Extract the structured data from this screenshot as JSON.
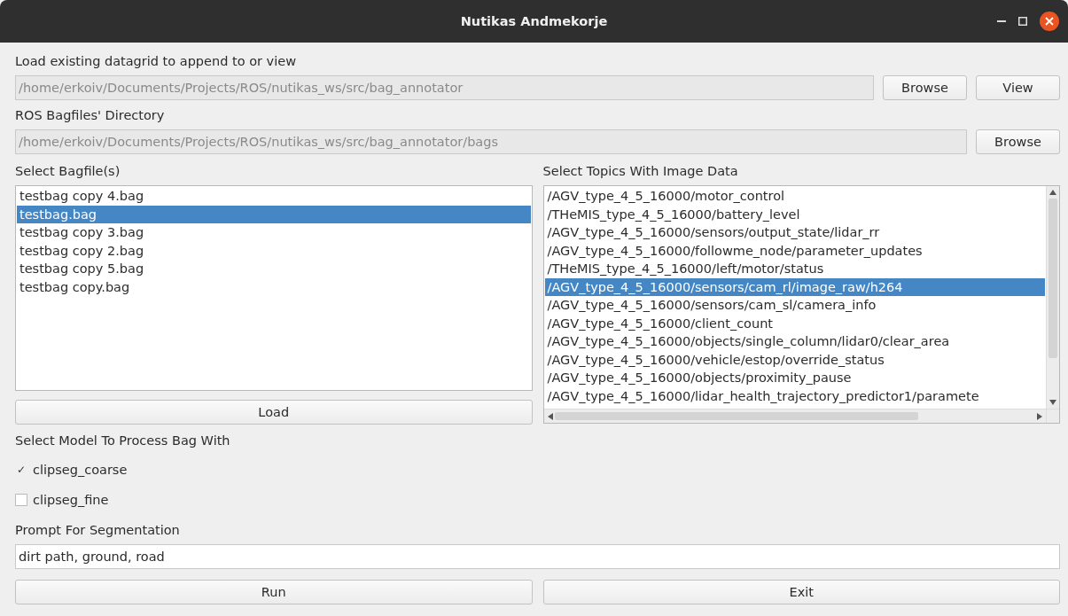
{
  "window": {
    "title": "Nutikas Andmekorje"
  },
  "datagrid": {
    "label": "Load existing datagrid to append to or view",
    "path": "/home/erkoiv/Documents/Projects/ROS/nutikas_ws/src/bag_annotator",
    "buttons": [
      "Browse",
      "View"
    ]
  },
  "bag_directory": {
    "label": "ROS Bagfiles' Directory",
    "path": "/home/erkoiv/Documents/Projects/ROS/nutikas_ws/src/bag_annotator/bags",
    "buttons": [
      "Browse"
    ]
  },
  "bagfiles": {
    "label": "Select Bagfile(s)",
    "items": [
      {
        "name": "testbag copy 4.bag",
        "selected": false
      },
      {
        "name": "testbag.bag",
        "selected": true
      },
      {
        "name": "testbag copy 3.bag",
        "selected": false
      },
      {
        "name": "testbag copy 2.bag",
        "selected": false
      },
      {
        "name": "testbag copy 5.bag",
        "selected": false
      },
      {
        "name": "testbag copy.bag",
        "selected": false
      }
    ],
    "button": "Load"
  },
  "topics": {
    "label": "Select Topics With Image Data",
    "items": [
      {
        "name": "/AGV_type_4_5_16000/motor_control",
        "selected": false
      },
      {
        "name": "/THeMIS_type_4_5_16000/battery_level",
        "selected": false
      },
      {
        "name": "/AGV_type_4_5_16000/sensors/output_state/lidar_rr",
        "selected": false
      },
      {
        "name": "/AGV_type_4_5_16000/followme_node/parameter_updates",
        "selected": false
      },
      {
        "name": "/THeMIS_type_4_5_16000/left/motor/status",
        "selected": false
      },
      {
        "name": "/AGV_type_4_5_16000/sensors/cam_rl/image_raw/h264",
        "selected": true
      },
      {
        "name": "/AGV_type_4_5_16000/sensors/cam_sl/camera_info",
        "selected": false
      },
      {
        "name": "/AGV_type_4_5_16000/client_count",
        "selected": false
      },
      {
        "name": "/AGV_type_4_5_16000/objects/single_column/lidar0/clear_area",
        "selected": false
      },
      {
        "name": "/AGV_type_4_5_16000/vehicle/estop/override_status",
        "selected": false
      },
      {
        "name": "/AGV_type_4_5_16000/objects/proximity_pause",
        "selected": false
      },
      {
        "name": "/AGV_type_4_5_16000/lidar_health_trajectory_predictor1/paramete",
        "selected": false
      }
    ]
  },
  "models": {
    "label": "Select Model To Process Bag With",
    "items": [
      {
        "name": "clipseg_coarse",
        "checked": true,
        "check_mark": "✓"
      },
      {
        "name": "clipseg_fine",
        "checked": false
      }
    ]
  },
  "prompt": {
    "label": "Prompt For Segmentation",
    "value": "dirt path, ground, road"
  },
  "actions": [
    "Run",
    "Exit"
  ]
}
